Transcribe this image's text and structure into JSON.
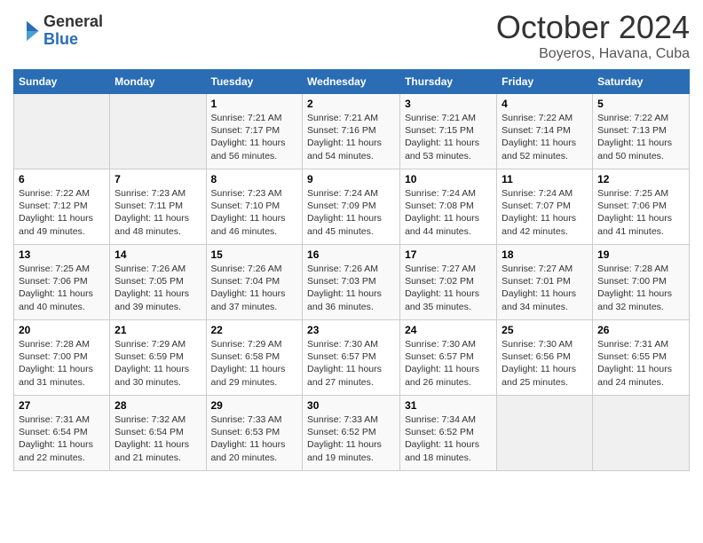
{
  "logo": {
    "general": "General",
    "blue": "Blue"
  },
  "title": {
    "month": "October 2024",
    "location": "Boyeros, Havana, Cuba"
  },
  "headers": [
    "Sunday",
    "Monday",
    "Tuesday",
    "Wednesday",
    "Thursday",
    "Friday",
    "Saturday"
  ],
  "weeks": [
    [
      {
        "day": "",
        "sunrise": "",
        "sunset": "",
        "daylight": ""
      },
      {
        "day": "",
        "sunrise": "",
        "sunset": "",
        "daylight": ""
      },
      {
        "day": "1",
        "sunrise": "Sunrise: 7:21 AM",
        "sunset": "Sunset: 7:17 PM",
        "daylight": "Daylight: 11 hours and 56 minutes."
      },
      {
        "day": "2",
        "sunrise": "Sunrise: 7:21 AM",
        "sunset": "Sunset: 7:16 PM",
        "daylight": "Daylight: 11 hours and 54 minutes."
      },
      {
        "day": "3",
        "sunrise": "Sunrise: 7:21 AM",
        "sunset": "Sunset: 7:15 PM",
        "daylight": "Daylight: 11 hours and 53 minutes."
      },
      {
        "day": "4",
        "sunrise": "Sunrise: 7:22 AM",
        "sunset": "Sunset: 7:14 PM",
        "daylight": "Daylight: 11 hours and 52 minutes."
      },
      {
        "day": "5",
        "sunrise": "Sunrise: 7:22 AM",
        "sunset": "Sunset: 7:13 PM",
        "daylight": "Daylight: 11 hours and 50 minutes."
      }
    ],
    [
      {
        "day": "6",
        "sunrise": "Sunrise: 7:22 AM",
        "sunset": "Sunset: 7:12 PM",
        "daylight": "Daylight: 11 hours and 49 minutes."
      },
      {
        "day": "7",
        "sunrise": "Sunrise: 7:23 AM",
        "sunset": "Sunset: 7:11 PM",
        "daylight": "Daylight: 11 hours and 48 minutes."
      },
      {
        "day": "8",
        "sunrise": "Sunrise: 7:23 AM",
        "sunset": "Sunset: 7:10 PM",
        "daylight": "Daylight: 11 hours and 46 minutes."
      },
      {
        "day": "9",
        "sunrise": "Sunrise: 7:24 AM",
        "sunset": "Sunset: 7:09 PM",
        "daylight": "Daylight: 11 hours and 45 minutes."
      },
      {
        "day": "10",
        "sunrise": "Sunrise: 7:24 AM",
        "sunset": "Sunset: 7:08 PM",
        "daylight": "Daylight: 11 hours and 44 minutes."
      },
      {
        "day": "11",
        "sunrise": "Sunrise: 7:24 AM",
        "sunset": "Sunset: 7:07 PM",
        "daylight": "Daylight: 11 hours and 42 minutes."
      },
      {
        "day": "12",
        "sunrise": "Sunrise: 7:25 AM",
        "sunset": "Sunset: 7:06 PM",
        "daylight": "Daylight: 11 hours and 41 minutes."
      }
    ],
    [
      {
        "day": "13",
        "sunrise": "Sunrise: 7:25 AM",
        "sunset": "Sunset: 7:06 PM",
        "daylight": "Daylight: 11 hours and 40 minutes."
      },
      {
        "day": "14",
        "sunrise": "Sunrise: 7:26 AM",
        "sunset": "Sunset: 7:05 PM",
        "daylight": "Daylight: 11 hours and 39 minutes."
      },
      {
        "day": "15",
        "sunrise": "Sunrise: 7:26 AM",
        "sunset": "Sunset: 7:04 PM",
        "daylight": "Daylight: 11 hours and 37 minutes."
      },
      {
        "day": "16",
        "sunrise": "Sunrise: 7:26 AM",
        "sunset": "Sunset: 7:03 PM",
        "daylight": "Daylight: 11 hours and 36 minutes."
      },
      {
        "day": "17",
        "sunrise": "Sunrise: 7:27 AM",
        "sunset": "Sunset: 7:02 PM",
        "daylight": "Daylight: 11 hours and 35 minutes."
      },
      {
        "day": "18",
        "sunrise": "Sunrise: 7:27 AM",
        "sunset": "Sunset: 7:01 PM",
        "daylight": "Daylight: 11 hours and 34 minutes."
      },
      {
        "day": "19",
        "sunrise": "Sunrise: 7:28 AM",
        "sunset": "Sunset: 7:00 PM",
        "daylight": "Daylight: 11 hours and 32 minutes."
      }
    ],
    [
      {
        "day": "20",
        "sunrise": "Sunrise: 7:28 AM",
        "sunset": "Sunset: 7:00 PM",
        "daylight": "Daylight: 11 hours and 31 minutes."
      },
      {
        "day": "21",
        "sunrise": "Sunrise: 7:29 AM",
        "sunset": "Sunset: 6:59 PM",
        "daylight": "Daylight: 11 hours and 30 minutes."
      },
      {
        "day": "22",
        "sunrise": "Sunrise: 7:29 AM",
        "sunset": "Sunset: 6:58 PM",
        "daylight": "Daylight: 11 hours and 29 minutes."
      },
      {
        "day": "23",
        "sunrise": "Sunrise: 7:30 AM",
        "sunset": "Sunset: 6:57 PM",
        "daylight": "Daylight: 11 hours and 27 minutes."
      },
      {
        "day": "24",
        "sunrise": "Sunrise: 7:30 AM",
        "sunset": "Sunset: 6:57 PM",
        "daylight": "Daylight: 11 hours and 26 minutes."
      },
      {
        "day": "25",
        "sunrise": "Sunrise: 7:30 AM",
        "sunset": "Sunset: 6:56 PM",
        "daylight": "Daylight: 11 hours and 25 minutes."
      },
      {
        "day": "26",
        "sunrise": "Sunrise: 7:31 AM",
        "sunset": "Sunset: 6:55 PM",
        "daylight": "Daylight: 11 hours and 24 minutes."
      }
    ],
    [
      {
        "day": "27",
        "sunrise": "Sunrise: 7:31 AM",
        "sunset": "Sunset: 6:54 PM",
        "daylight": "Daylight: 11 hours and 22 minutes."
      },
      {
        "day": "28",
        "sunrise": "Sunrise: 7:32 AM",
        "sunset": "Sunset: 6:54 PM",
        "daylight": "Daylight: 11 hours and 21 minutes."
      },
      {
        "day": "29",
        "sunrise": "Sunrise: 7:33 AM",
        "sunset": "Sunset: 6:53 PM",
        "daylight": "Daylight: 11 hours and 20 minutes."
      },
      {
        "day": "30",
        "sunrise": "Sunrise: 7:33 AM",
        "sunset": "Sunset: 6:52 PM",
        "daylight": "Daylight: 11 hours and 19 minutes."
      },
      {
        "day": "31",
        "sunrise": "Sunrise: 7:34 AM",
        "sunset": "Sunset: 6:52 PM",
        "daylight": "Daylight: 11 hours and 18 minutes."
      },
      {
        "day": "",
        "sunrise": "",
        "sunset": "",
        "daylight": ""
      },
      {
        "day": "",
        "sunrise": "",
        "sunset": "",
        "daylight": ""
      }
    ]
  ]
}
